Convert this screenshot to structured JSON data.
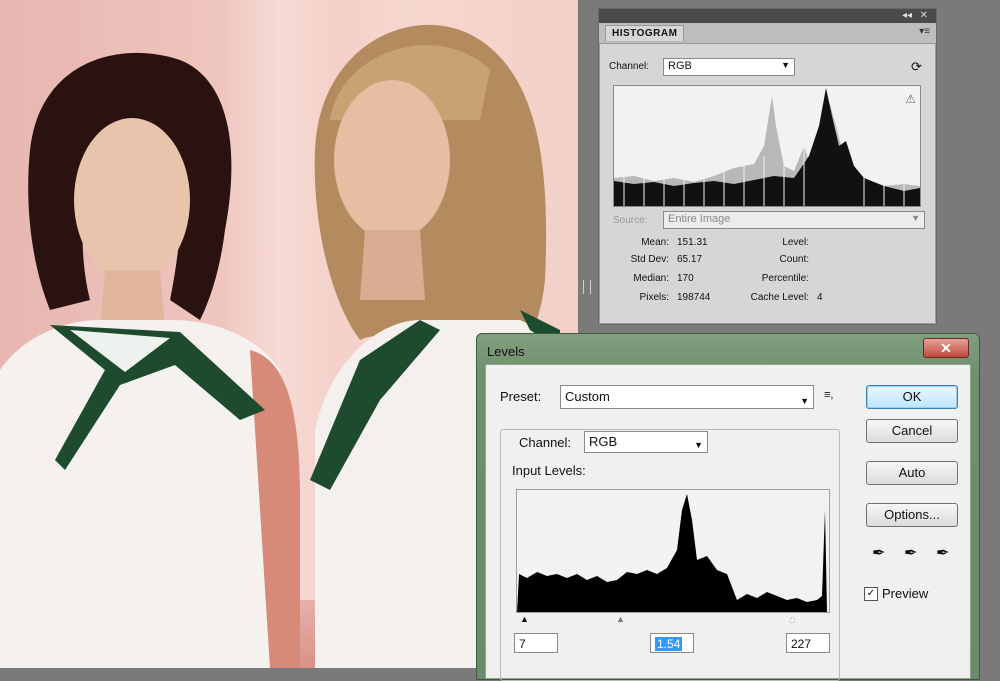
{
  "histogram_panel": {
    "tab_label": "HISTOGRAM",
    "channel_label": "Channel:",
    "channel_value": "RGB",
    "source_label": "Source:",
    "source_value": "Entire Image",
    "stats": {
      "mean_label": "Mean:",
      "mean_value": "151.31",
      "stddev_label": "Std Dev:",
      "stddev_value": "65.17",
      "median_label": "Median:",
      "median_value": "170",
      "pixels_label": "Pixels:",
      "pixels_value": "198744",
      "level_label": "Level:",
      "count_label": "Count:",
      "percentile_label": "Percentile:",
      "cache_label": "Cache Level:",
      "cache_value": "4"
    }
  },
  "levels_dialog": {
    "title": "Levels",
    "close_glyph": "✕",
    "preset_label": "Preset:",
    "preset_value": "Custom",
    "channel_label": "Channel:",
    "channel_value": "RGB",
    "input_levels_label": "Input Levels:",
    "input_black": "7",
    "input_gamma": "1.54",
    "input_white": "227",
    "buttons": {
      "ok": "OK",
      "cancel": "Cancel",
      "auto": "Auto",
      "options": "Options..."
    },
    "preview_label": "Preview",
    "preview_checked": true
  },
  "colors": {
    "dialog_frame": "#6f8f6f",
    "panel_bg": "#d6d6d6",
    "ok_accent": "#3c7fb1"
  }
}
